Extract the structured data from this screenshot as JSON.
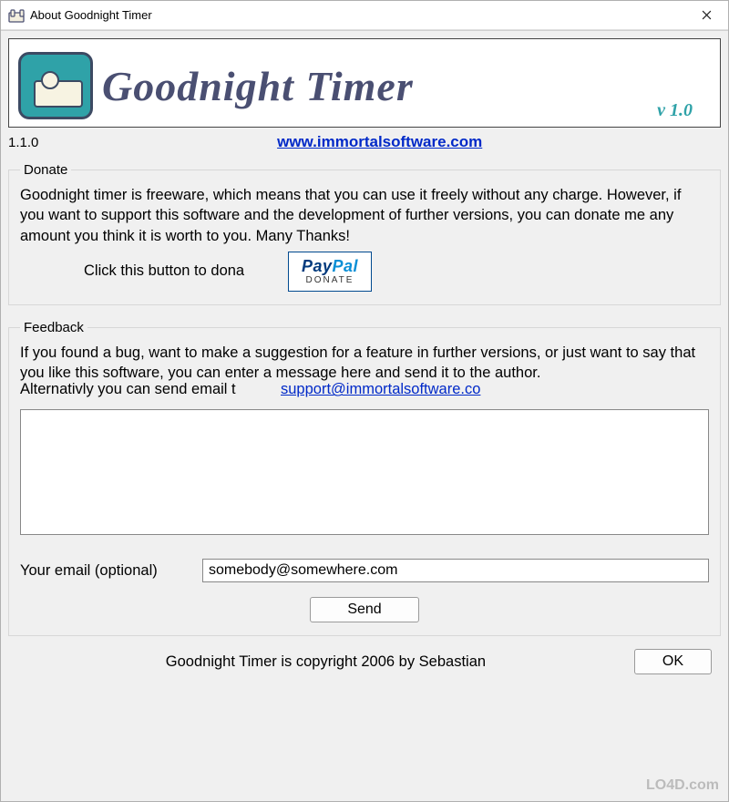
{
  "window": {
    "title": "About Goodnight Timer"
  },
  "banner": {
    "title": "Goodnight Timer",
    "version": "v 1.0"
  },
  "version_text": "1.1.0",
  "site_url": "www.immortalsoftware.com",
  "donate": {
    "legend": "Donate",
    "body": "Goodnight timer is freeware, which means that you can use it freely without any charge. However, if you want to support this software and the development of further versions, you can donate me any amount you think it is worth to you. Many Thanks!",
    "button_label": "Click this button to dona",
    "paypal_top_pay": "Pay",
    "paypal_top_pal": "Pal",
    "paypal_sub": "DONATE"
  },
  "feedback": {
    "legend": "Feedback",
    "body": "If you found a bug, want to make a suggestion for a feature in further versions, or just want to say that you like this software, you can enter a message here and send it to the author.",
    "alt_text": "Alternativly you can send email t",
    "support_email": "support@immortalsoftware.co",
    "message_value": "",
    "email_label": "Your email (optional)",
    "email_value": "somebody@somewhere.com",
    "send_label": "Send"
  },
  "copyright": "Goodnight Timer is copyright 2006 by Sebastian",
  "ok_label": "OK",
  "watermark": "LO4D.com"
}
